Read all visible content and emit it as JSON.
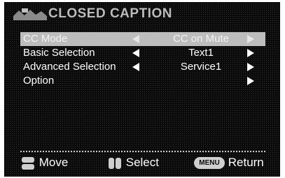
{
  "header": {
    "title": "CLOSED CAPTION",
    "icon": "tv-screen-icon"
  },
  "rows": [
    {
      "label": "CC Mode",
      "value": "CC on Mute",
      "selected": true
    },
    {
      "label": "Basic Selection",
      "value": "Text1",
      "selected": false
    },
    {
      "label": "Advanced Selection",
      "value": "Service1",
      "selected": false
    },
    {
      "label": "Option",
      "value": "",
      "selected": false
    }
  ],
  "footer": {
    "move_label": "Move",
    "select_label": "Select",
    "menu_key": "MENU",
    "return_label": "Return"
  },
  "colors": {
    "background": "#0a0a0a",
    "highlight": "#bdbdbd",
    "text": "#ffffff"
  }
}
